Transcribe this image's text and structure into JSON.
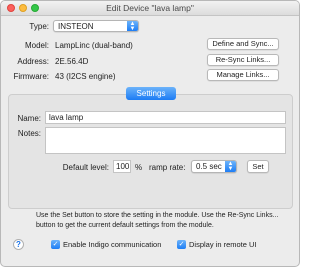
{
  "window": {
    "title": "Edit Device \"lava lamp\""
  },
  "device": {
    "type_label": "Type:",
    "type_value": "INSTEON",
    "model_label": "Model:",
    "model_value": "LampLinc (dual-band)",
    "address_label": "Address:",
    "address_value": "2E.56.4D",
    "firmware_label": "Firmware:",
    "firmware_value": "43 (I2CS engine)"
  },
  "buttons": {
    "define_sync": "Define and Sync...",
    "resync_links": "Re-Sync Links...",
    "manage_links": "Manage Links...",
    "set": "Set"
  },
  "settings": {
    "tab_label": "Settings",
    "name_label": "Name:",
    "name_value": "lava lamp",
    "notes_label": "Notes:",
    "notes_value": "",
    "default_level_label": "Default level:",
    "default_level_value": "100",
    "default_level_unit": "%",
    "ramp_rate_label": "ramp rate:",
    "ramp_rate_value": "0.5 sec"
  },
  "help_text": "Use the Set button to store the setting in the module. Use the Re-Sync Links... button to get the current default settings from the module.",
  "footer": {
    "help_icon": "question-mark",
    "enable_label": "Enable Indigo communication",
    "enable_checked": true,
    "display_label": "Display in remote UI",
    "display_checked": true
  },
  "colors": {
    "accent": "#1e7ef5",
    "window_bg": "#ececec"
  }
}
